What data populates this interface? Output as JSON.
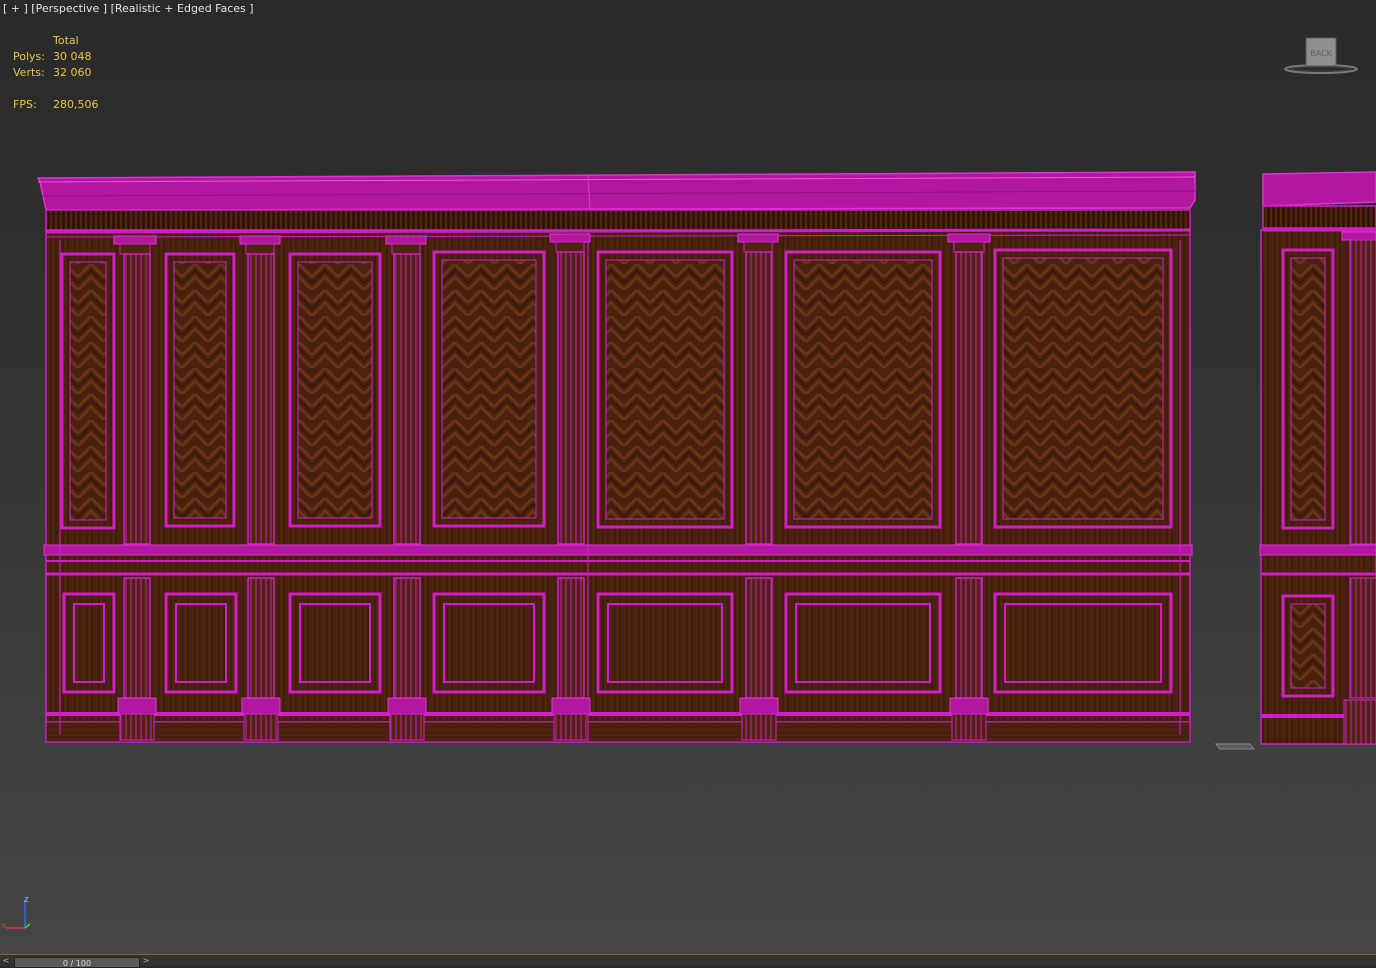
{
  "viewport": {
    "label_parts": [
      "[ + ]",
      "[Perspective ]",
      "[Realistic + Edged Faces ]"
    ]
  },
  "stats": {
    "header": "Total",
    "polys_label": "Polys:",
    "polys_value": "30 048",
    "verts_label": "Verts:",
    "verts_value": "32 060",
    "fps_label": "FPS:",
    "fps_value": "280,506"
  },
  "viewcube": {
    "face_label": "BACK"
  },
  "axis": {
    "z_label": "z",
    "x_label": "x"
  },
  "timeline": {
    "frame_text": "0 / 100",
    "left_arrow": "<",
    "right_arrow": ">"
  },
  "colors": {
    "edge": "#d21ec8",
    "wood_dark": "#3c1a09",
    "wood_mid": "#6b3414",
    "stat_text": "#e8c63c",
    "label_text": "#e6e6e6"
  }
}
